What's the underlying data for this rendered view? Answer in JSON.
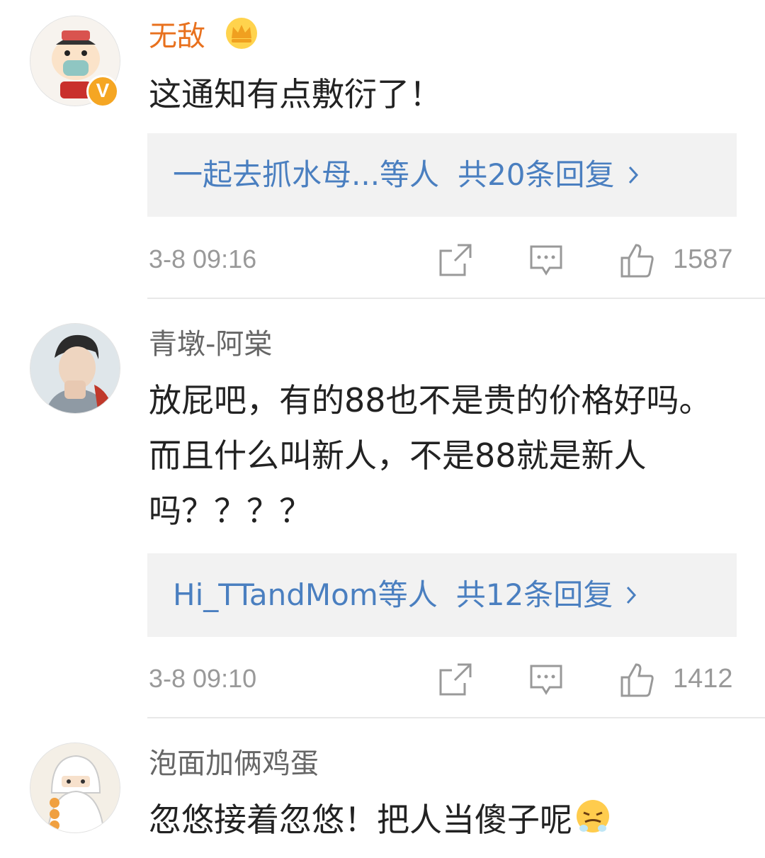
{
  "comments": [
    {
      "user": "无敌",
      "text": "这通知有点敷衍了！",
      "replies_prefix": "一起去抓水母...等人",
      "replies_count": "共20条回复",
      "time": "3-8 09:16",
      "likes": "1587",
      "verified_badge": "V"
    },
    {
      "user": "青墩-阿棠",
      "text": "放屁吧，有的88也不是贵的价格好吗。而且什么叫新人，不是88就是新人吗？？？？",
      "replies_prefix": "Hi_TTandMom等人",
      "replies_count": "共12条回复",
      "time": "3-8 09:10",
      "likes": "1412"
    },
    {
      "user": "泡面加俩鸡蛋",
      "text": "忽悠接着忽悠！把人当傻子呢"
    }
  ],
  "icons": {
    "forward": "forward-icon",
    "comment": "comment-icon",
    "like": "like-icon",
    "chevron": "chevron-right-icon",
    "crown": "crown-icon",
    "emoji": "steaming-face-icon"
  },
  "colors": {
    "vip_name": "#e8711e",
    "reply_link": "#4a7fc0",
    "muted": "#999999",
    "reply_bg": "#f2f2f2"
  }
}
